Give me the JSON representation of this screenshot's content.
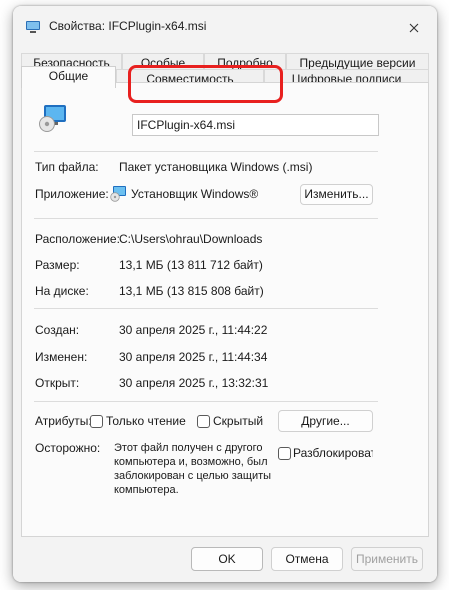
{
  "window": {
    "title": "Свойства: IFCPlugin-x64.msi"
  },
  "tabs": {
    "row_back": [
      "Безопасность",
      "Особые",
      "Подробно",
      "Предыдущие версии"
    ],
    "row_front": [
      "Общие",
      "Совместимость",
      "Цифровые подписи"
    ],
    "active": "Общие"
  },
  "general": {
    "file_name": "IFCPlugin-x64.msi",
    "file_type_label": "Тип файла:",
    "file_type_value": "Пакет установщика Windows (.msi)",
    "app_label": "Приложение:",
    "app_value": "Установщик Windows®",
    "change_button": "Изменить...",
    "location_label": "Расположение:",
    "location_value": "C:\\Users\\ohrau\\Downloads",
    "size_label": "Размер:",
    "size_value": "13,1 МБ (13 811 712 байт)",
    "disk_label": "На диске:",
    "disk_value": "13,1 МБ (13 815 808 байт)",
    "created_label": "Создан:",
    "created_value": "30 апреля 2025 г., 11:44:22",
    "modified_label": "Изменен:",
    "modified_value": "30 апреля 2025 г., 11:44:34",
    "opened_label": "Открыт:",
    "opened_value": "30 апреля 2025 г., 13:32:31",
    "attributes_label": "Атрибуты:",
    "readonly_label": "Только чтение",
    "hidden_label": "Скрытый",
    "other_button": "Другие...",
    "caution_label": "Осторожно:",
    "caution_text": "Этот файл получен с другого\nкомпьютера и, возможно, был\nзаблокирован с целью защиты\nкомпьютера.",
    "unblock_label": "Разблокироват"
  },
  "footer": {
    "ok": "OK",
    "cancel": "Отмена",
    "apply": "Применить"
  },
  "colors": {
    "highlight": "#e8201f",
    "window_bg": "#f3f3f3",
    "panel_bg": "#fbfbfb"
  }
}
